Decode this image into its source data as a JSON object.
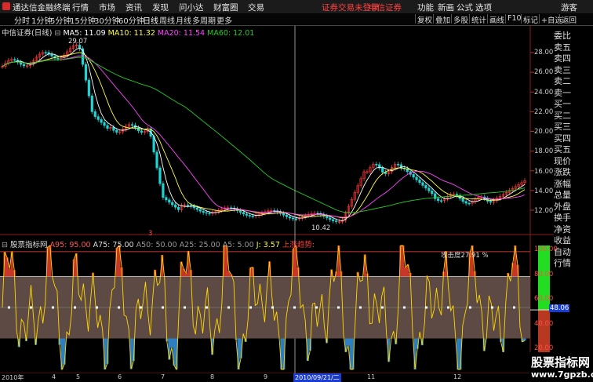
{
  "app": {
    "title": "通达信金融终端",
    "menu": [
      "行情",
      "市场",
      "资讯",
      "发现",
      "问小达",
      "财富圈",
      "交易"
    ],
    "notices": [
      "证券交易未登录",
      "中信证券"
    ],
    "right_menu": [
      "功能",
      "新画",
      "公式",
      "选项",
      "游客"
    ]
  },
  "toolbar": {
    "periods": [
      "分时",
      "1分钟",
      "5分钟",
      "15分钟",
      "30分钟",
      "60分钟",
      "日线",
      "周线",
      "月线",
      "多周期",
      "更多"
    ],
    "active_period": "日线",
    "right_buttons": [
      "复权",
      "叠加",
      "多股",
      "统计",
      "画线",
      "F10",
      "标记",
      "+自选",
      "返回"
    ]
  },
  "main_chart": {
    "title": "中信证券(日线)",
    "ma_labels": [
      "MA5: 11.09",
      "MA10: 11.32",
      "MA20: 11.54",
      "MA60: 12.01"
    ],
    "high_label": "29.07",
    "low_label": "10.42",
    "y_ticks": [
      "28.00",
      "26.00",
      "24.00",
      "22.00",
      "20.00",
      "18.00",
      "16.00",
      "14.00",
      "12.00"
    ],
    "marker_label": "3"
  },
  "indicator": {
    "name": "股票指标网",
    "values": [
      "A95: 95.00",
      "A75: 75.00",
      "A50: 50.00",
      "A25: 25.00",
      "A5: 5.00",
      "J: 3.57"
    ],
    "signal_label": "上涨趋势:",
    "attack_label": "攻击度27.91 %",
    "current_value": "48.06",
    "y_ticks": [
      "100.00",
      "80.00",
      "60.00",
      "40.00",
      "20.00"
    ]
  },
  "date_axis": {
    "labels": [
      "2010年",
      "4",
      "5",
      "6",
      "7",
      "8",
      "9",
      "10",
      "11",
      "12"
    ],
    "cursor_date": "2010/09/21/二"
  },
  "side_panel": {
    "items": [
      "委比",
      "卖五",
      "卖四",
      "卖三",
      "卖二",
      "卖一",
      "买一",
      "买二",
      "买三",
      "买四",
      "买五",
      "现价",
      "涨跌",
      "涨幅",
      "总量",
      "外盘",
      "换手",
      "净资",
      "收益",
      "自动",
      "行情"
    ]
  },
  "watermark": {
    "line1": "股票指标网",
    "line2": "www.7gpzb.com"
  },
  "colors": {
    "up": "#ff3b3b",
    "down": "#22d3d3",
    "ma5": "#ffffff",
    "ma10": "#ffff3a",
    "ma20": "#ff44ff",
    "ma60": "#22cc22",
    "panel_brown": "#5e4a44",
    "panel_red": "#c8372a",
    "panel_blue": "#2d7fc2"
  }
}
